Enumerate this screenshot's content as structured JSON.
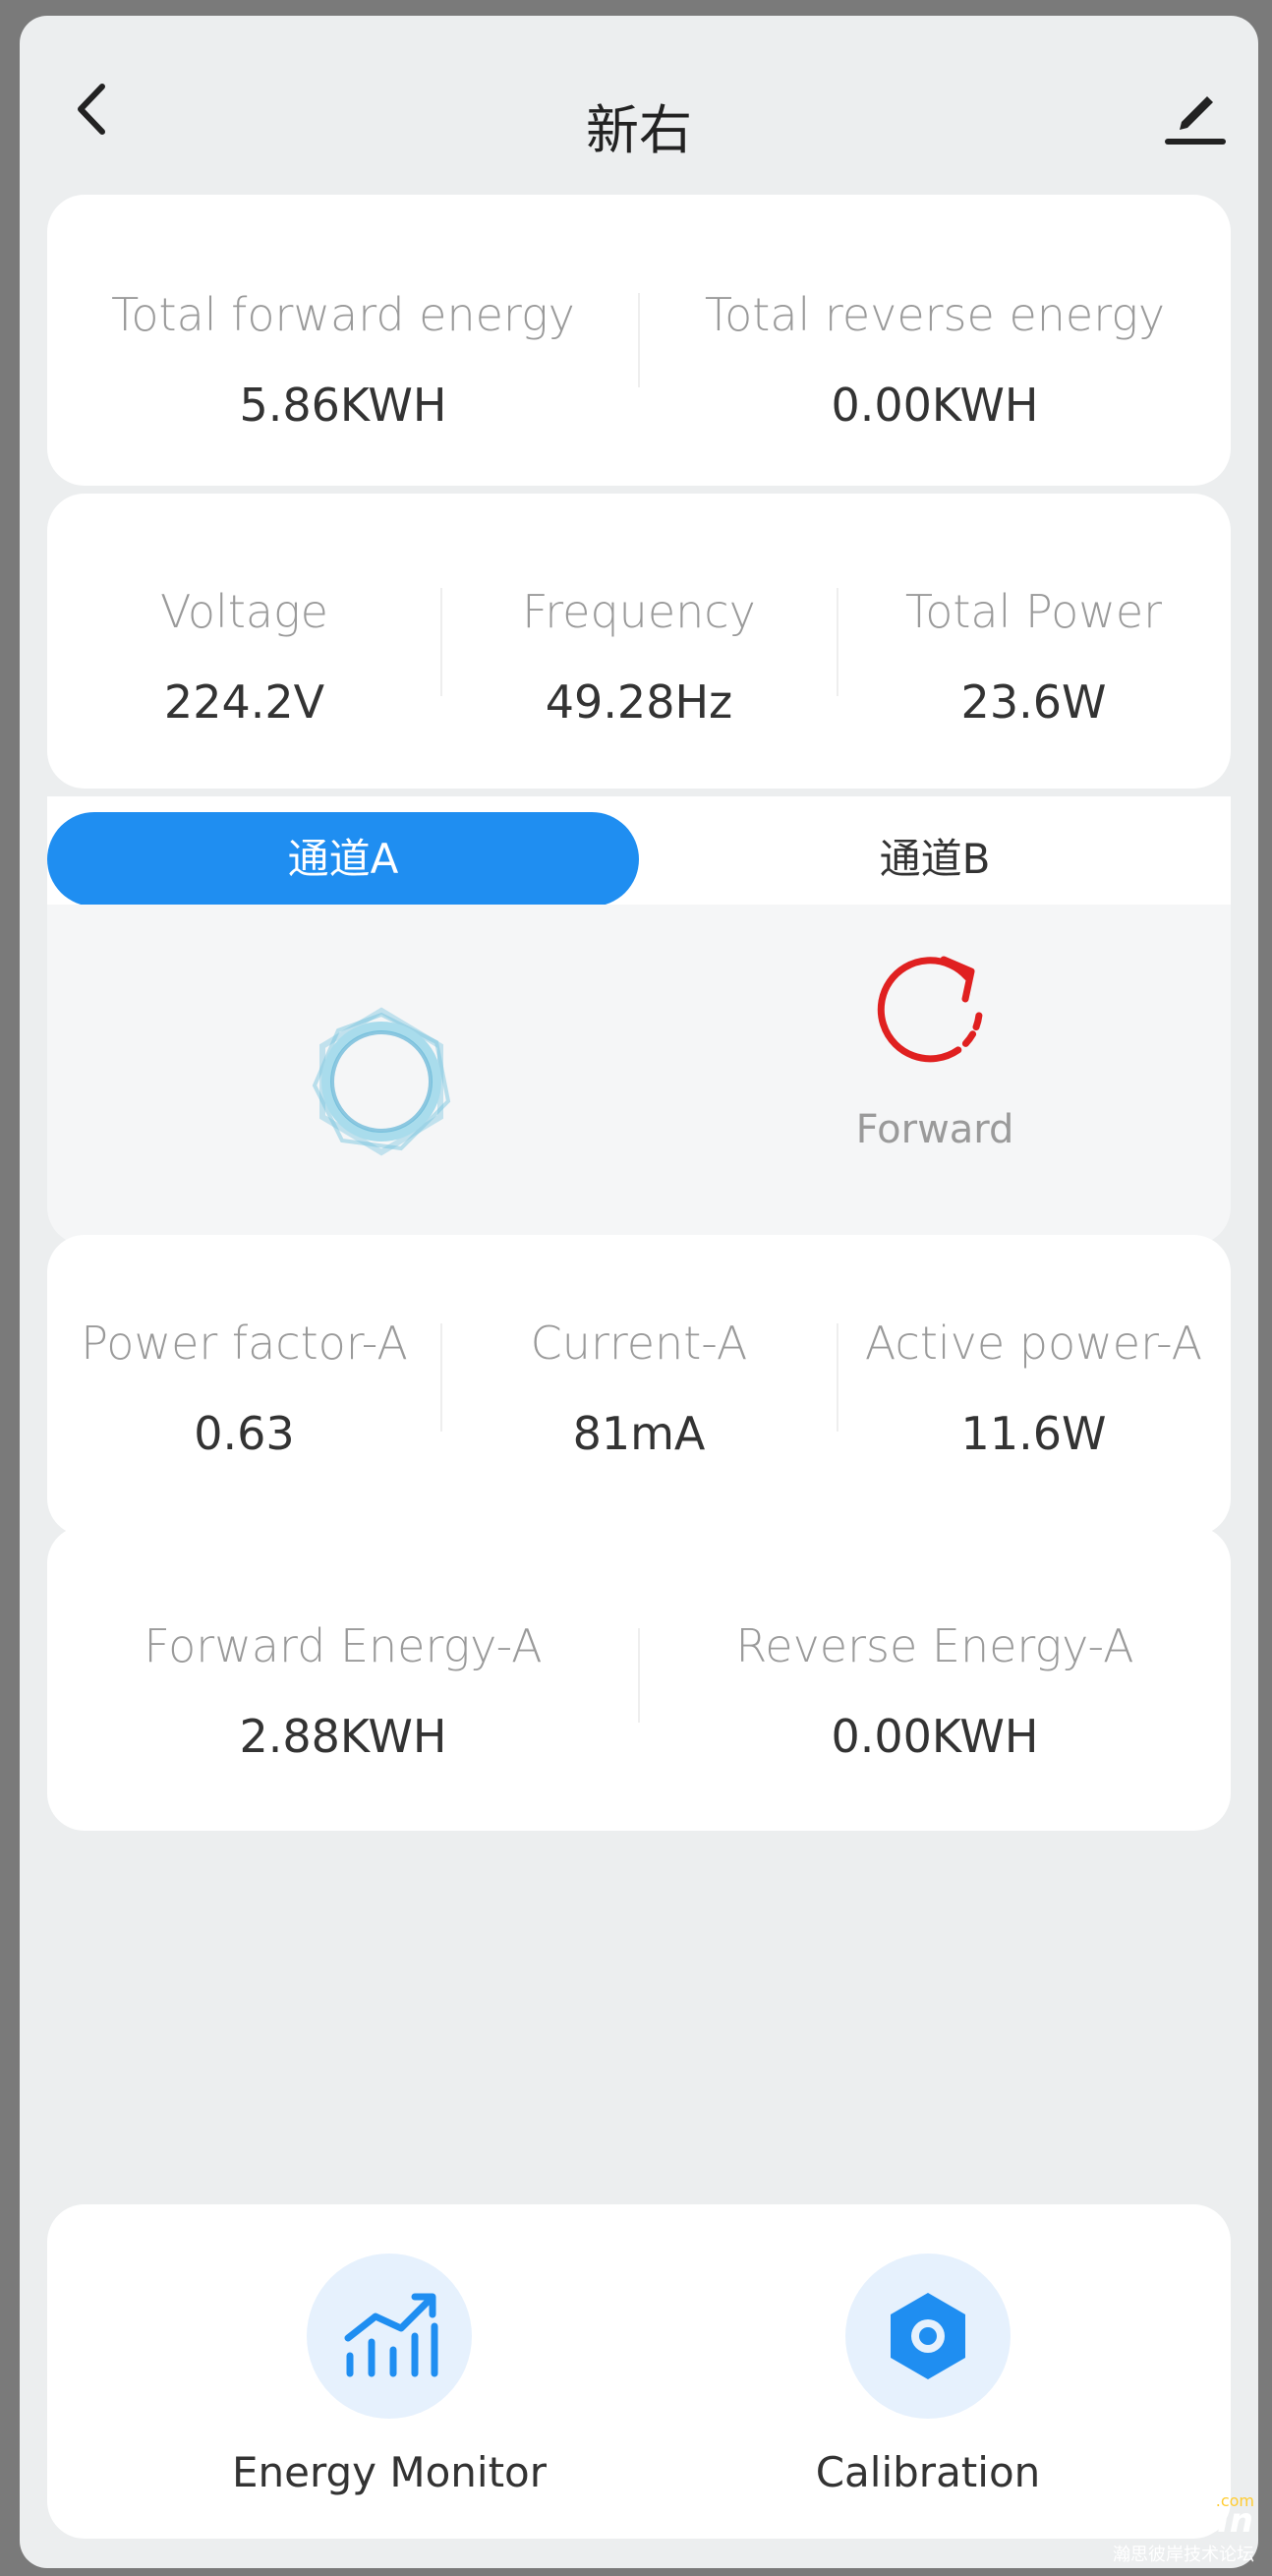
{
  "header": {
    "title": "新右"
  },
  "total_energy": {
    "forward_label": "Total forward energy",
    "forward_value": "5.86KWH",
    "reverse_label": "Total reverse energy",
    "reverse_value": "0.00KWH"
  },
  "metrics": {
    "voltage_label": "Voltage",
    "voltage_value": "224.2V",
    "frequency_label": "Frequency",
    "frequency_value": "49.28Hz",
    "total_power_label": "Total Power",
    "total_power_value": "23.6W"
  },
  "tabs": {
    "channel_a": "通道A",
    "channel_b": "通道B",
    "selected": "channel_a"
  },
  "status": {
    "direction_label": "Forward"
  },
  "channel_metrics": {
    "power_factor_label": "Power factor-A",
    "power_factor_value": "0.63",
    "current_label": "Current-A",
    "current_value": "81mA",
    "active_power_label": "Active power-A",
    "active_power_value": "11.6W"
  },
  "channel_energy": {
    "forward_label": "Forward Energy-A",
    "forward_value": "2.88KWH",
    "reverse_label": "Reverse Energy-A",
    "reverse_value": "0.00KWH"
  },
  "bottom_features": {
    "energy_monitor_label": "Energy Monitor",
    "calibration_label": "Calibration"
  },
  "watermark": {
    "main": "Hassbian",
    "sub": "瀚思彼岸技术论坛",
    "com": ".com"
  },
  "colors": {
    "accent": "#1f8ef1",
    "forward_icon": "#e02020",
    "page_bg": "#eceeef",
    "card_bg": "#ffffff"
  },
  "icons": {
    "back": "chevron-left-icon",
    "edit": "pencil-icon",
    "loading": "loading-ring-icon",
    "forward": "rotate-clockwise-icon",
    "energy_monitor": "bar-chart-trend-icon",
    "calibration": "hexagon-nut-icon"
  }
}
